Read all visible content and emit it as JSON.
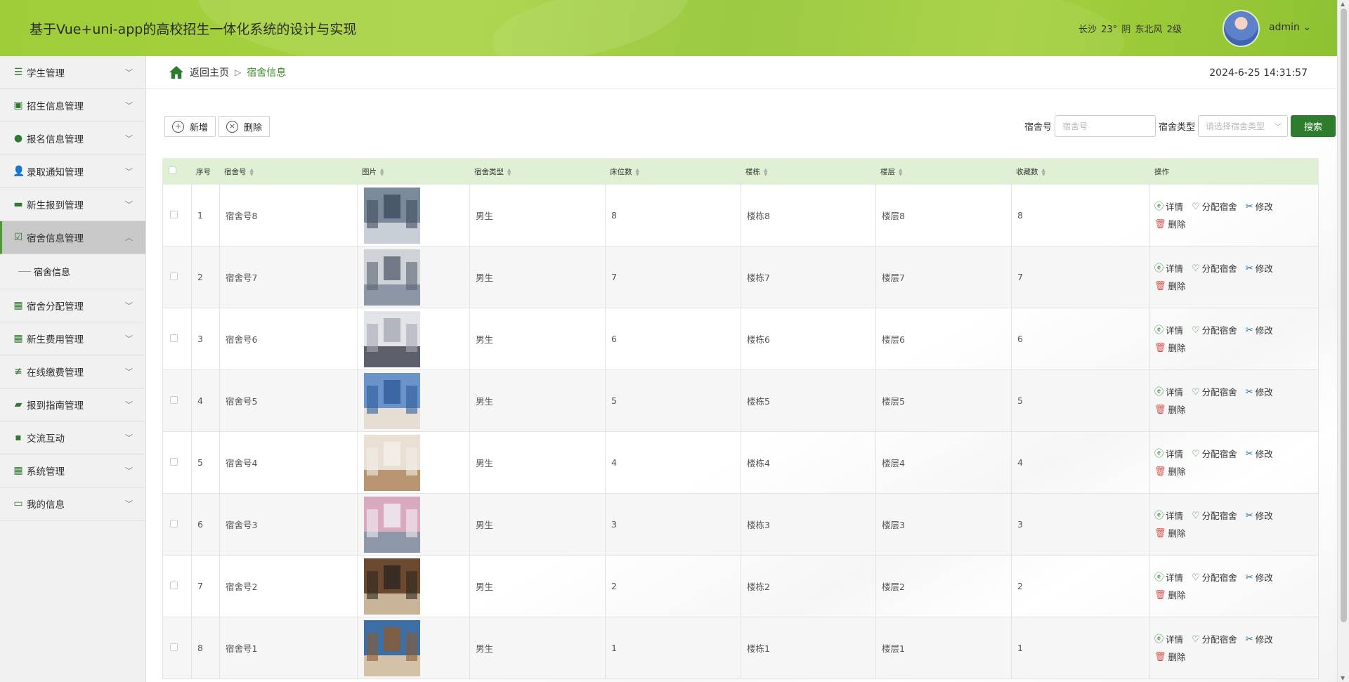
{
  "header": {
    "title": "基于Vue+uni-app的高校招生一体化系统的设计与实现",
    "weather": "长沙 23° 阴 东北风 2级",
    "username": "admin ⌄"
  },
  "sidebar": {
    "items": [
      {
        "label": "学生管理",
        "icon": "list-icon"
      },
      {
        "label": "招生信息管理",
        "icon": "briefcase-icon"
      },
      {
        "label": "报名信息管理",
        "icon": "pin-icon"
      },
      {
        "label": "录取通知管理",
        "icon": "user-icon"
      },
      {
        "label": "新生报到管理",
        "icon": "inbox-icon"
      },
      {
        "label": "宿舍信息管理",
        "icon": "clipboard-check-icon"
      },
      {
        "label": "宿舍分配管理",
        "icon": "grid-icon"
      },
      {
        "label": "新生费用管理",
        "icon": "grid-icon"
      },
      {
        "label": "在线缴费管理",
        "icon": "sliders-icon"
      },
      {
        "label": "报到指南管理",
        "icon": "wallet-icon"
      },
      {
        "label": "交流互动",
        "icon": "chat-icon"
      },
      {
        "label": "系统管理",
        "icon": "grid-icon"
      },
      {
        "label": "我的信息",
        "icon": "card-icon"
      }
    ],
    "submenu_label": "宿舍信息"
  },
  "breadcrumb": {
    "home": "返回主页",
    "separator": "▷",
    "current": "宿舍信息"
  },
  "datetime": "2024-6-25 14:31:57",
  "toolbar": {
    "add_label": "新增",
    "delete_label": "删除"
  },
  "search": {
    "room_label": "宿舍号",
    "room_placeholder": "宿舍号",
    "type_label": "宿舍类型",
    "type_placeholder": "请选择宿舍类型",
    "button_label": "搜索"
  },
  "table": {
    "columns": [
      "序号",
      "宿舍号",
      "图片",
      "宿舍类型",
      "床位数",
      "楼栋",
      "楼层",
      "收藏数",
      "操作"
    ],
    "ops": {
      "detail": "详情",
      "assign": "分配宿舍",
      "edit": "修改",
      "delete": "删除"
    },
    "rows": [
      {
        "no": "1",
        "room": "宿舍号8",
        "type": "男生",
        "beds": "8",
        "building": "楼栋8",
        "floor": "楼层8",
        "favorites": "8"
      },
      {
        "no": "2",
        "room": "宿舍号7",
        "type": "男生",
        "beds": "7",
        "building": "楼栋7",
        "floor": "楼层7",
        "favorites": "7"
      },
      {
        "no": "3",
        "room": "宿舍号6",
        "type": "男生",
        "beds": "6",
        "building": "楼栋6",
        "floor": "楼层6",
        "favorites": "6"
      },
      {
        "no": "4",
        "room": "宿舍号5",
        "type": "男生",
        "beds": "5",
        "building": "楼栋5",
        "floor": "楼层5",
        "favorites": "5"
      },
      {
        "no": "5",
        "room": "宿舍号4",
        "type": "男生",
        "beds": "4",
        "building": "楼栋4",
        "floor": "楼层4",
        "favorites": "4"
      },
      {
        "no": "6",
        "room": "宿舍号3",
        "type": "男生",
        "beds": "3",
        "building": "楼栋3",
        "floor": "楼层3",
        "favorites": "3"
      },
      {
        "no": "7",
        "room": "宿舍号2",
        "type": "男生",
        "beds": "2",
        "building": "楼栋2",
        "floor": "楼层2",
        "favorites": "2"
      },
      {
        "no": "8",
        "room": "宿舍号1",
        "type": "男生",
        "beds": "1",
        "building": "楼栋1",
        "floor": "楼层1",
        "favorites": "1"
      }
    ]
  },
  "colors": {
    "accent": "#2e7d2e",
    "header_bg": "#a3cf3c",
    "table_header_bg": "#dff0d4"
  }
}
